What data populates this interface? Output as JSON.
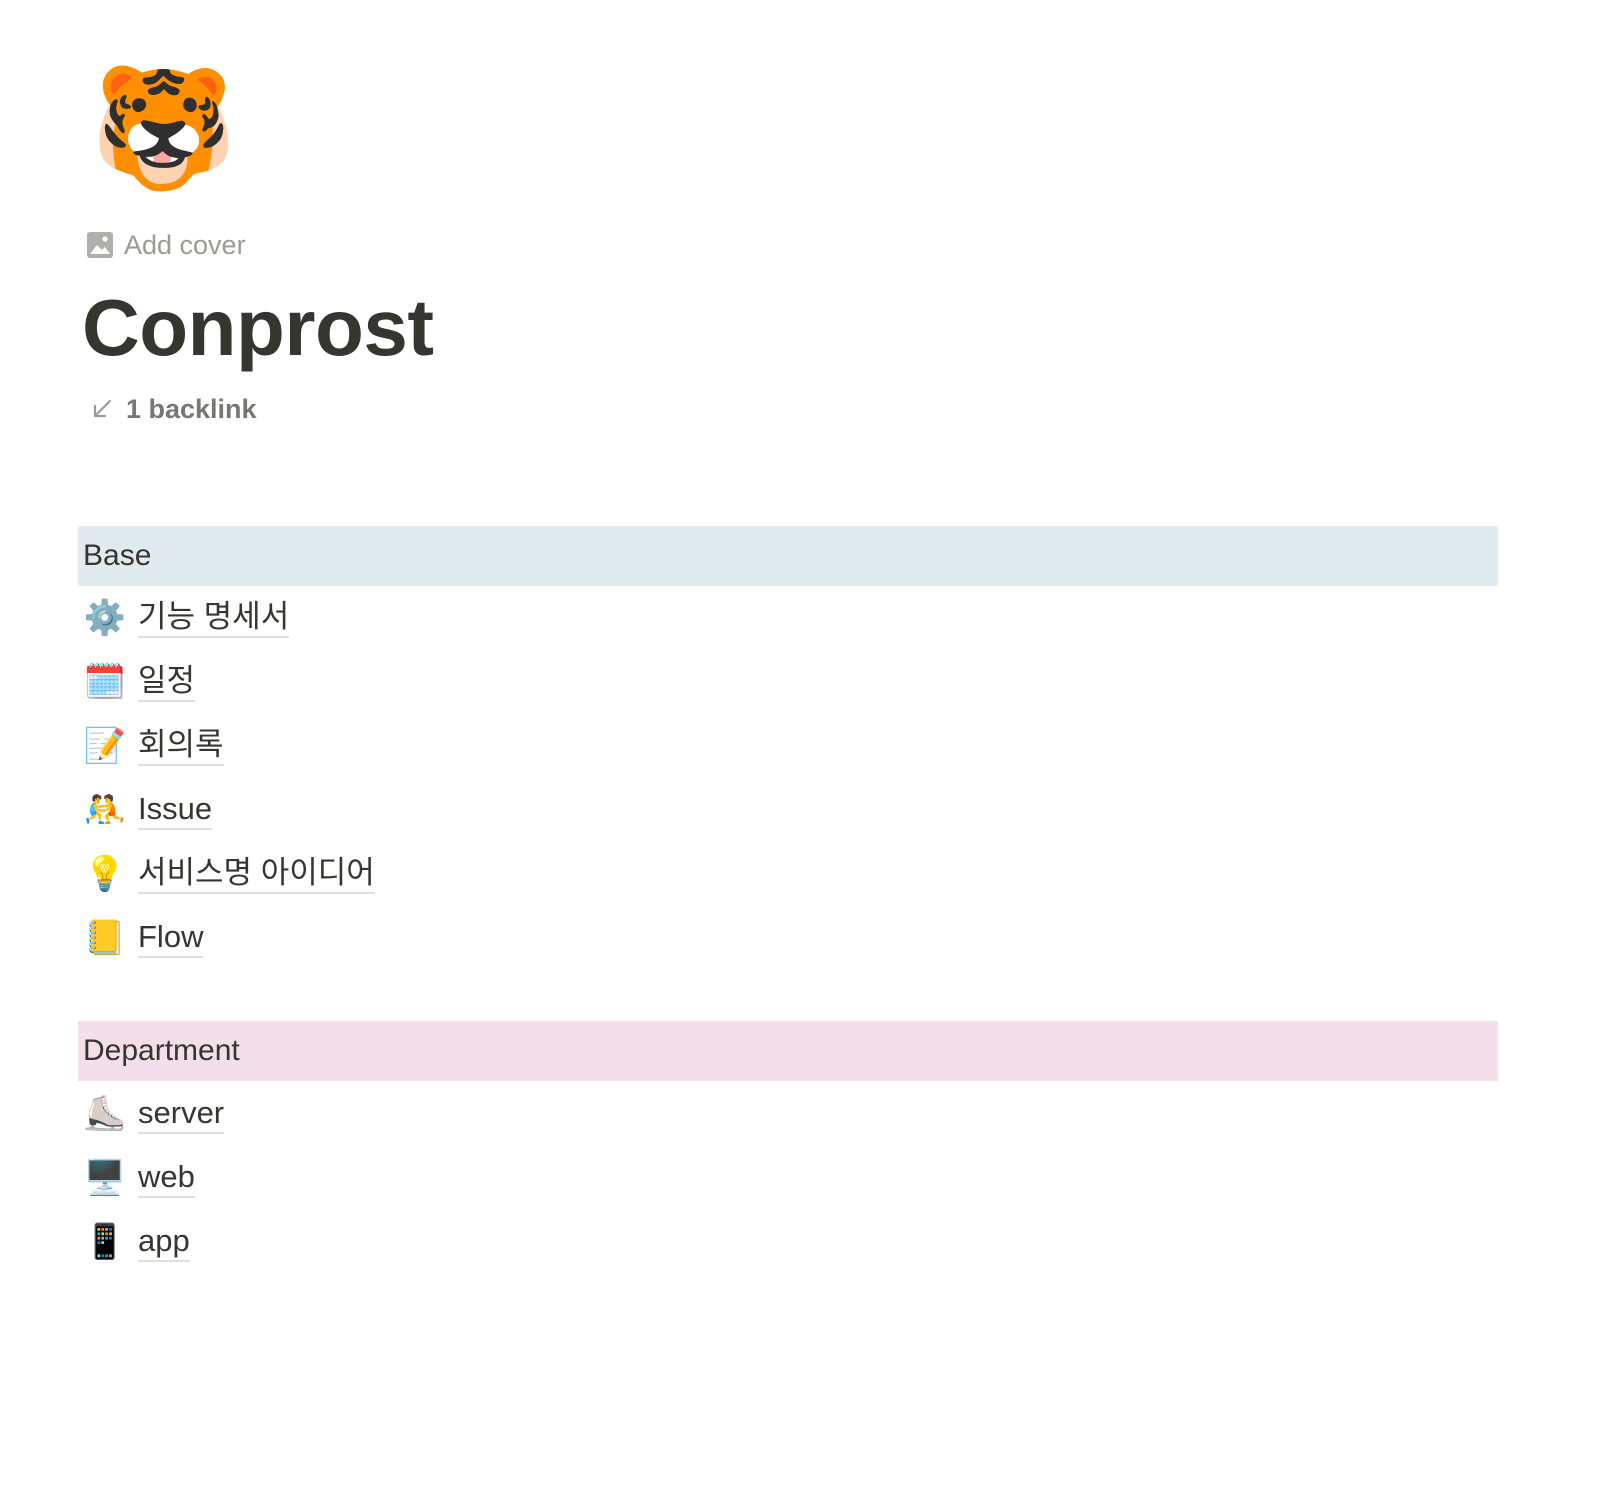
{
  "page": {
    "icon": "🐯",
    "add_cover_label": "Add cover",
    "title": "Conprost",
    "backlinks_label": "1 backlink"
  },
  "sections": [
    {
      "title": "Base",
      "background": "#e1ebef",
      "items": [
        {
          "emoji": "⚙️",
          "label": "기능 명세서"
        },
        {
          "emoji": "🗓️",
          "label": "일정"
        },
        {
          "emoji": "📝",
          "label": "회의록"
        },
        {
          "emoji": "🤼",
          "label": "Issue"
        },
        {
          "emoji": "💡",
          "label": "서비스명 아이디어"
        },
        {
          "emoji": "📒",
          "label": "Flow"
        }
      ]
    },
    {
      "title": "Department",
      "background": "#f2dfe9",
      "items": [
        {
          "emoji": "⛸️",
          "label": "server"
        },
        {
          "emoji": "🖥️",
          "label": "web"
        },
        {
          "emoji": "📱",
          "label": "app"
        }
      ]
    }
  ],
  "colors": {
    "text": "#37352f",
    "muted": "#9b9a97",
    "base_header_bg": "#e1ebef",
    "department_header_bg": "#f2dfe9"
  }
}
